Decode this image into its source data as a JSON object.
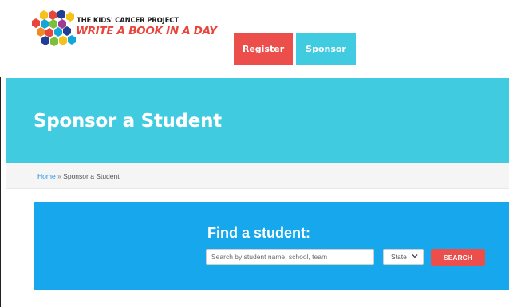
{
  "logo": {
    "line1": "THE KIDS' CANCER PROJECT",
    "line2": "WRITE A BOOK IN A DAY"
  },
  "nav": {
    "register_label": "Register",
    "sponsor_label": "Sponsor"
  },
  "hero": {
    "title": "Sponsor a Student"
  },
  "breadcrumb": {
    "home": "Home",
    "separator": "»",
    "current": "Sponsor a Student"
  },
  "find": {
    "title": "Find a student:",
    "search_placeholder": "Search by student name, school, team",
    "state_value": "State",
    "search_button": "SEARCH"
  },
  "colors": {
    "accent_red": "#ec4f4b",
    "accent_cyan": "#40cbe0",
    "panel_blue": "#17a7ec"
  }
}
